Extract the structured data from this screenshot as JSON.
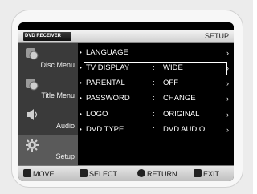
{
  "header": {
    "brand": "DVD RECEIVER",
    "title": "SETUP"
  },
  "sidebar": {
    "items": [
      {
        "label": "Disc Menu",
        "icon": "disc-icon"
      },
      {
        "label": "Title Menu",
        "icon": "title-icon"
      },
      {
        "label": "Audio",
        "icon": "speaker-icon"
      },
      {
        "label": "Setup",
        "icon": "gear-icon"
      }
    ]
  },
  "menu": {
    "rows": [
      {
        "name": "LANGUAGE",
        "colon": "",
        "value": "",
        "arrow": "›"
      },
      {
        "name": "TV DISPLAY",
        "colon": ":",
        "value": "WIDE",
        "arrow": "›"
      },
      {
        "name": "PARENTAL",
        "colon": ":",
        "value": "OFF",
        "arrow": "›"
      },
      {
        "name": "PASSWORD",
        "colon": ":",
        "value": "CHANGE",
        "arrow": "›"
      },
      {
        "name": "LOGO",
        "colon": ":",
        "value": "ORIGINAL",
        "arrow": "›"
      },
      {
        "name": "DVD TYPE",
        "colon": ":",
        "value": "DVD AUDIO",
        "arrow": "›"
      }
    ],
    "bullet": "•"
  },
  "footer": {
    "move": "MOVE",
    "select": "SELECT",
    "return": "RETURN",
    "exit": "EXIT"
  }
}
